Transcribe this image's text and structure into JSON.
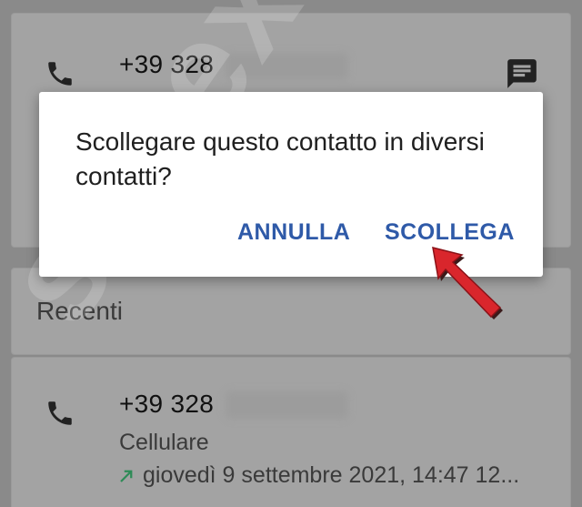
{
  "contact": {
    "number": "+39 328"
  },
  "recents": {
    "section_label": "Recenti",
    "entry": {
      "number": "+39 328",
      "type": "Cellulare",
      "datetime": "giovedì 9 settembre 2021, 14:47 12..."
    }
  },
  "dialog": {
    "message": "Scollegare questo contatto in diversi contatti?",
    "cancel_label": "ANNULLA",
    "unlink_label": "SCOLLEGA"
  },
  "watermark": {
    "text": "senex.it"
  },
  "icons": {
    "phone": "phone-icon",
    "message": "message-icon",
    "outgoing_call": "outgoing-call-arrow-icon",
    "pointer": "red-arrow-pointer-icon"
  },
  "colors": {
    "accent_button": "#2f5aa8",
    "pointer_arrow": "#d9262c",
    "outgoing_arrow": "#2e8b57",
    "scrim": "#8a8a8a"
  }
}
